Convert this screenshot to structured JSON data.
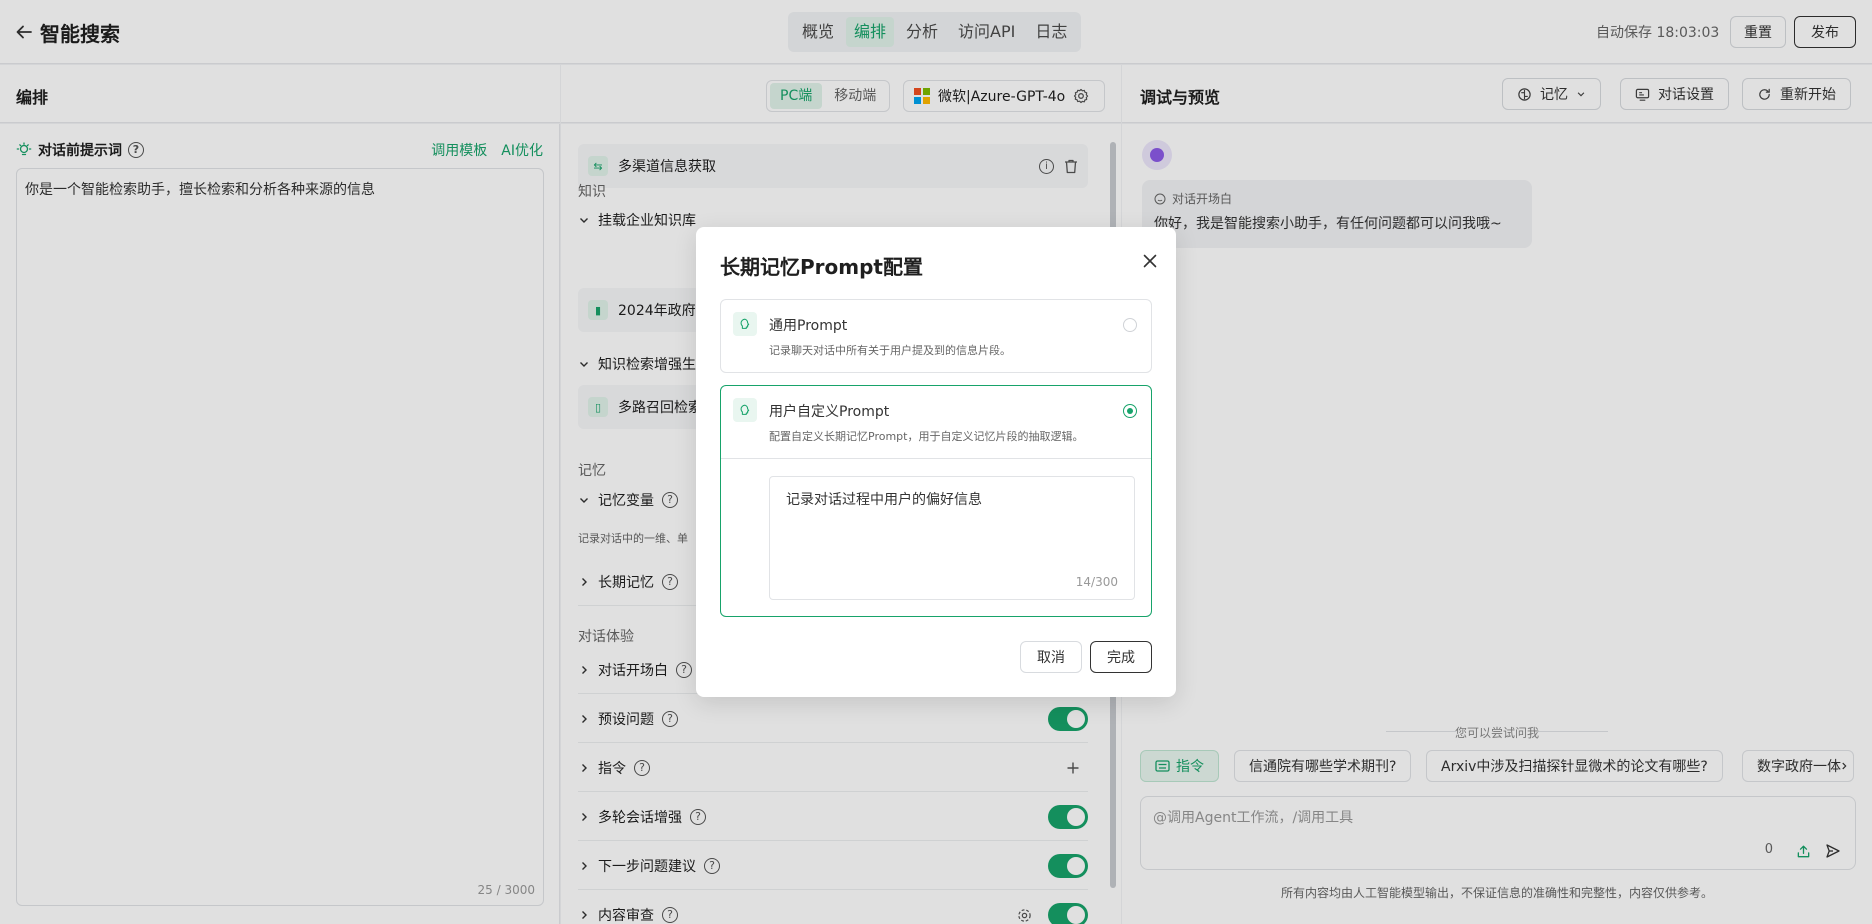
{
  "header": {
    "title": "智能搜索",
    "tabs": [
      "概览",
      "编排",
      "分析",
      "访问API",
      "日志"
    ],
    "active_tab": "编排",
    "autosave": "自动保存 18:03:03",
    "reset": "重置",
    "publish": "发布"
  },
  "left": {
    "title": "编排",
    "prompt_label": "对话前提示词",
    "template_link": "调用模板",
    "ai_link": "AI优化",
    "prompt_text": "你是一个智能检索助手，擅长检索和分析各种来源的信息",
    "prompt_count": "25 / 3000"
  },
  "toolbar": {
    "pc": "PC端",
    "mobile": "移动端",
    "model": "微软|Azure-GPT-4o"
  },
  "config": {
    "workflow_card": "多渠道信息获取",
    "knowledge_label": "知识",
    "kb_row": "挂载企业知识库",
    "kb_card": "2024年政府工",
    "enhance_row": "知识检索增强生",
    "recall_card": "多路召回检索",
    "memory_label": "记忆",
    "memory_var_row": "记忆变量",
    "memory_var_desc": "记录对话中的一维、单",
    "long_memory_row": "长期记忆",
    "experience_label": "对话体验",
    "opening_row": "对话开场白",
    "preset_row": "预设问题",
    "command_row": "指令",
    "multiturn_row": "多轮会话增强",
    "next_row": "下一步问题建议",
    "review_row": "内容审查"
  },
  "right": {
    "title": "调试与预览",
    "memory_btn": "记忆",
    "settings_btn": "对话设置",
    "restart_btn": "重新开始",
    "opening_label": "对话开场白",
    "opening_text": "你好，我是智能搜索小助手，有任何问题都可以问我哦~",
    "try_label": "您可以尝试问我",
    "chips": [
      "指令",
      "信通院有哪些学术期刊?",
      "Arxiv中涉及扫描探针显微术的论文有哪些?",
      "数字政府一体"
    ],
    "input_placeholder": "@调用Agent工作流，/调用工具",
    "input_count": "0",
    "disclaimer": "所有内容均由人工智能模型输出，不保证信息的准确性和完整性，内容仅供参考。"
  },
  "modal": {
    "title": "长期记忆Prompt配置",
    "option1_title": "通用Prompt",
    "option1_desc": "记录聊天对话中所有关于用户提及到的信息片段。",
    "option2_title": "用户自定义Prompt",
    "option2_desc": "配置自定义长期记忆Prompt，用于自定义记忆片段的抽取逻辑。",
    "custom_text": "记录对话过程中用户的偏好信息",
    "custom_count": "14/300",
    "cancel": "取消",
    "ok": "完成"
  },
  "colors": {
    "accent": "#17a36a",
    "accent_bg": "#e1f3ea"
  }
}
